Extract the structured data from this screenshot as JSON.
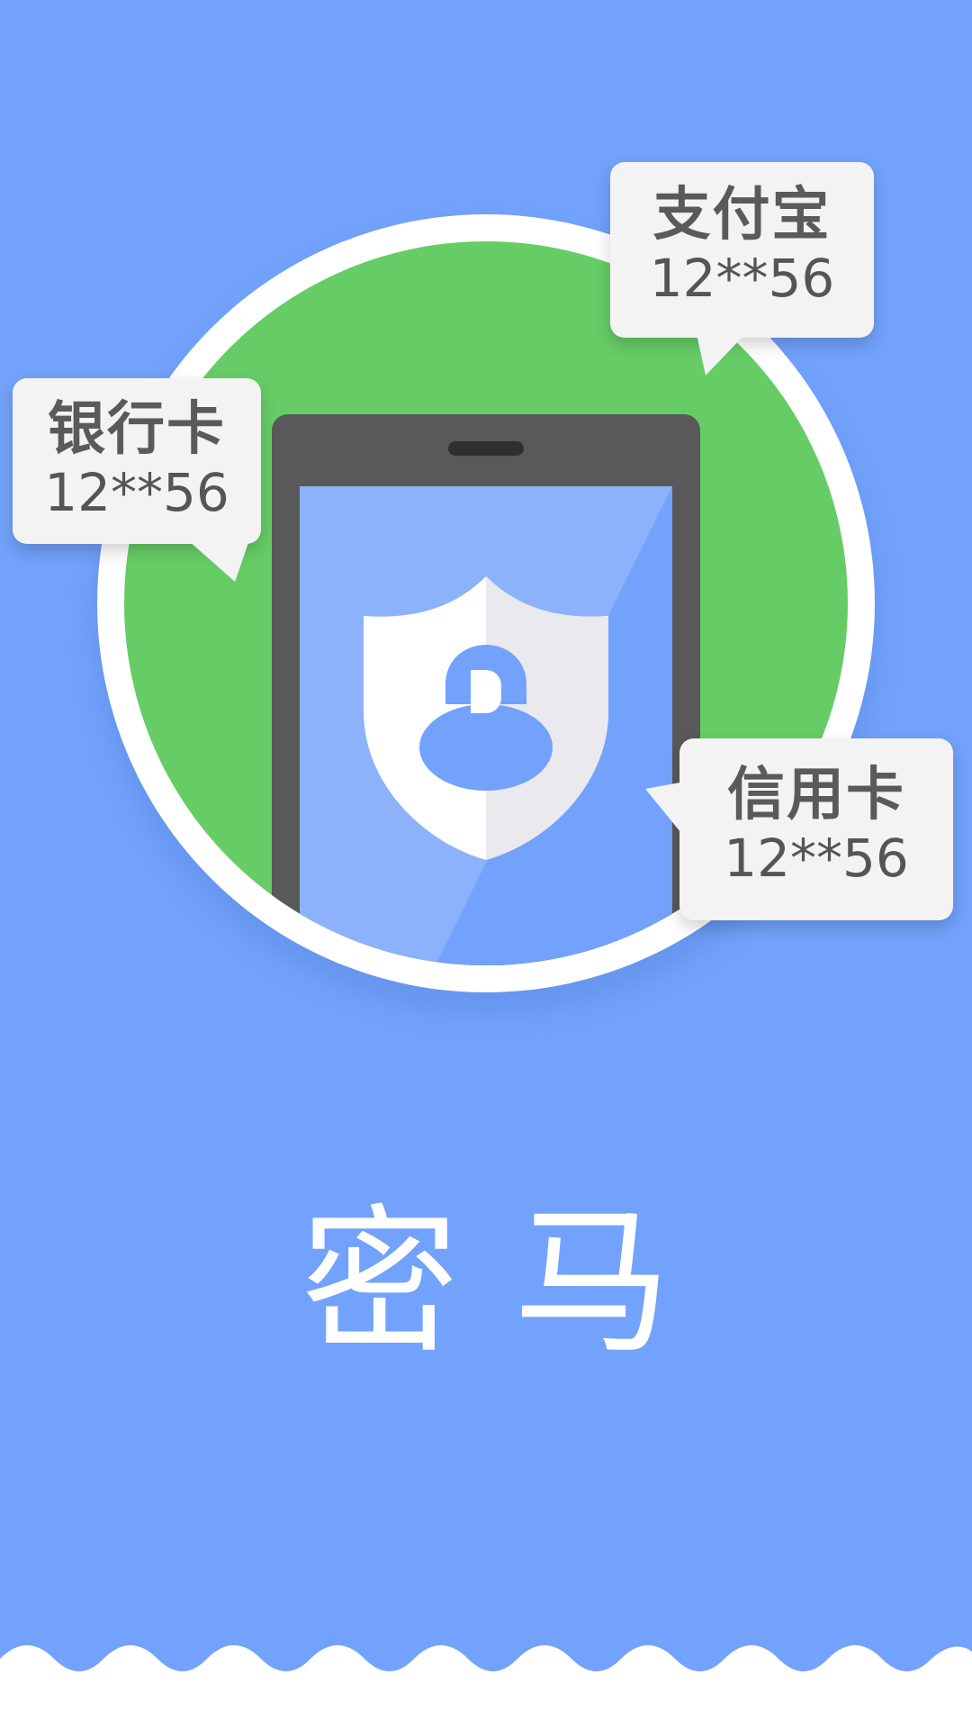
{
  "colors": {
    "background": "#72a2fb",
    "circle_fill": "#66cc66",
    "circle_ring": "#ffffff",
    "phone_body": "#595959",
    "phone_screen": "#72a2fb",
    "shield": "#ffffff",
    "bubble": "#f3f3f3",
    "bubble_text": "#555555"
  },
  "icons": {
    "hero": "phone-shield-lock-icon"
  },
  "bubbles": [
    {
      "name": "支付宝",
      "code": "12**56"
    },
    {
      "name": "银行卡",
      "code": "12**56"
    },
    {
      "name": "信用卡",
      "code": "12**56"
    }
  ],
  "title": "密马"
}
